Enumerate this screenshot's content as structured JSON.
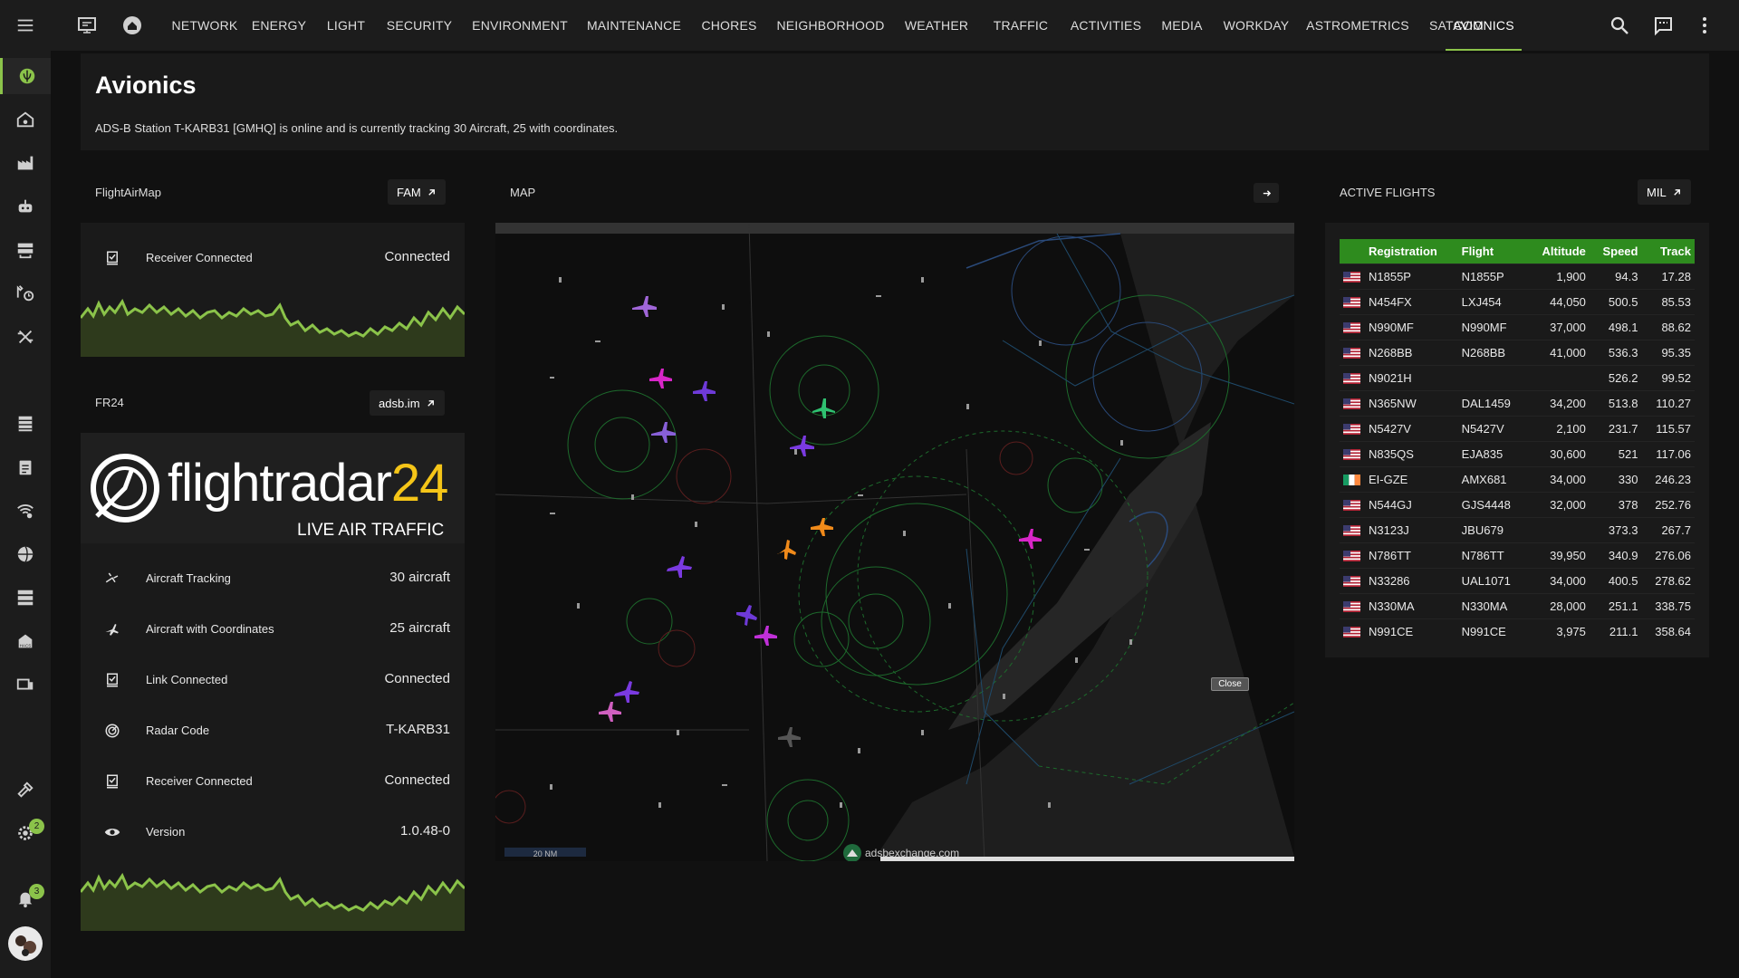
{
  "nav": {
    "tabs": [
      "NETWORK",
      "ENERGY",
      "LIGHT",
      "SECURITY",
      "ENVIRONMENT",
      "MAINTENANCE",
      "CHORES",
      "NEIGHBORHOOD",
      "WEATHER",
      "TRAFFIC",
      "ACTIVITIES",
      "MEDIA",
      "WORKDAY",
      "ASTROMETRICS",
      "SATCOM",
      "AVIONICS"
    ],
    "active_tab": "AVIONICS"
  },
  "sidebar": {
    "icons": [
      "menu-icon",
      "rebel-logo-icon",
      "home-gear-icon",
      "factory-icon",
      "robot-icon",
      "server-rack-icon",
      "wrench-clock-icon",
      "tools-icon",
      "film-strip-icon",
      "clipboard-icon",
      "wifi-gear-icon",
      "globe-icon",
      "server-icon",
      "hacs-icon",
      "devices-icon",
      "hammer-icon",
      "settings-icon",
      "bell-icon",
      "avatar"
    ],
    "settings_badge": "2",
    "notifications_badge": "3",
    "accent_color": "#8bc34a"
  },
  "header": {
    "title": "Avionics",
    "subtitle": "ADS-B Station T-KARB31 [GMHQ] is online and is currently tracking 30 Aircraft, 25 with coordinates."
  },
  "flightairmap": {
    "title": "FlightAirMap",
    "link_label": "FAM",
    "receiver_label": "Receiver Connected",
    "receiver_value": "Connected"
  },
  "fr24": {
    "title": "FR24",
    "link_label": "adsb.im",
    "logo_text": "flightradar",
    "logo_num": "24",
    "logo_tagline": "LIVE AIR TRAFFIC",
    "rows": [
      {
        "label": "Aircraft Tracking",
        "value": "30 aircraft",
        "icon": "airplane-radar-icon"
      },
      {
        "label": "Aircraft with Coordinates",
        "value": "25 aircraft",
        "icon": "airplane-marker-icon"
      },
      {
        "label": "Link Connected",
        "value": "Connected",
        "icon": "link-check-icon"
      },
      {
        "label": "Radar Code",
        "value": "T-KARB31",
        "icon": "radar-icon"
      },
      {
        "label": "Receiver Connected",
        "value": "Connected",
        "icon": "receiver-check-icon"
      },
      {
        "label": "Version",
        "value": "1.0.48-0",
        "icon": "eye-icon"
      }
    ]
  },
  "map": {
    "title": "MAP",
    "close_label": "Close",
    "attribution": "adsbexchange.com",
    "scale_label": "20 NM"
  },
  "active_flights": {
    "title": "ACTIVE FLIGHTS",
    "link_label": "MIL",
    "header_color": "#2e8b1e",
    "columns": [
      "Registration",
      "Flight",
      "Altitude",
      "Speed",
      "Track"
    ],
    "rows": [
      {
        "flag": "us",
        "reg": "N1855P",
        "flight": "N1855P",
        "alt": "1,900",
        "speed": "94.3",
        "track": "17.28"
      },
      {
        "flag": "us",
        "reg": "N454FX",
        "flight": "LXJ454",
        "alt": "44,050",
        "speed": "500.5",
        "track": "85.53"
      },
      {
        "flag": "us",
        "reg": "N990MF",
        "flight": "N990MF",
        "alt": "37,000",
        "speed": "498.1",
        "track": "88.62"
      },
      {
        "flag": "us",
        "reg": "N268BB",
        "flight": "N268BB",
        "alt": "41,000",
        "speed": "536.3",
        "track": "95.35"
      },
      {
        "flag": "us",
        "reg": "N9021H",
        "flight": "",
        "alt": "",
        "speed": "526.2",
        "track": "99.52"
      },
      {
        "flag": "us",
        "reg": "N365NW",
        "flight": "DAL1459",
        "alt": "34,200",
        "speed": "513.8",
        "track": "110.27"
      },
      {
        "flag": "us",
        "reg": "N5427V",
        "flight": "N5427V",
        "alt": "2,100",
        "speed": "231.7",
        "track": "115.57"
      },
      {
        "flag": "us",
        "reg": "N835QS",
        "flight": "EJA835",
        "alt": "30,600",
        "speed": "521",
        "track": "117.06"
      },
      {
        "flag": "ie",
        "reg": "EI-GZE",
        "flight": "AMX681",
        "alt": "34,000",
        "speed": "330",
        "track": "246.23"
      },
      {
        "flag": "us",
        "reg": "N544GJ",
        "flight": "GJS4448",
        "alt": "32,000",
        "speed": "378",
        "track": "252.76"
      },
      {
        "flag": "us",
        "reg": "N3123J",
        "flight": "JBU679",
        "alt": "",
        "speed": "373.3",
        "track": "267.7"
      },
      {
        "flag": "us",
        "reg": "N786TT",
        "flight": "N786TT",
        "alt": "39,950",
        "speed": "340.9",
        "track": "276.06"
      },
      {
        "flag": "us",
        "reg": "N33286",
        "flight": "UAL1071",
        "alt": "34,000",
        "speed": "400.5",
        "track": "278.62"
      },
      {
        "flag": "us",
        "reg": "N330MA",
        "flight": "N330MA",
        "alt": "28,000",
        "speed": "251.1",
        "track": "338.75"
      },
      {
        "flag": "us",
        "reg": "N991CE",
        "flight": "N991CE",
        "alt": "3,975",
        "speed": "211.1",
        "track": "358.64"
      }
    ]
  },
  "sparkline_color": "#8bc34a"
}
